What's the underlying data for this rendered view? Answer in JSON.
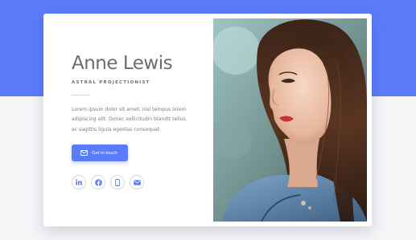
{
  "profile": {
    "name": "Anne Lewis",
    "role": "ASTRAL PROJECTIONIST",
    "bio": "Lorem ipsum dolor sit amet, nisl tempus lorem adipiscing elit. Donec sollicitudin blandit tellus, ac sagittis ligula egestas consequat."
  },
  "cta": {
    "label": "Get in touch",
    "icon": "envelope-icon"
  },
  "social": [
    {
      "icon": "linkedin-icon"
    },
    {
      "icon": "facebook-icon"
    },
    {
      "icon": "mobile-phone-icon"
    },
    {
      "icon": "envelope-icon"
    }
  ],
  "colors": {
    "accent": "#5b7cfa",
    "background": "#f4f5f7",
    "card": "#ffffff",
    "heading": "#6c6c73",
    "body_text": "#7b7d84"
  }
}
